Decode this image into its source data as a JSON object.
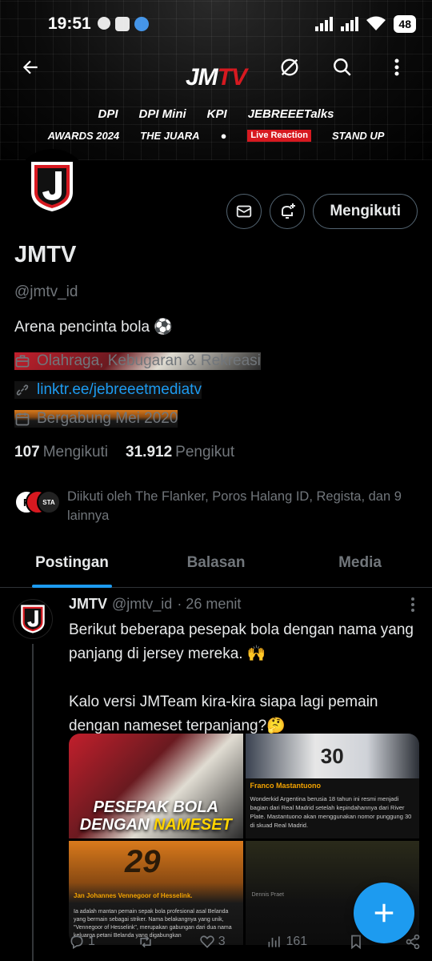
{
  "status_bar": {
    "time": "19:51",
    "battery": "48"
  },
  "banner": {
    "brand_main": "JM",
    "brand_accent": "TV",
    "logos_row1": [
      "DPI",
      "DPI Mini",
      "KPI",
      "JEBREEETalks"
    ],
    "logos_row2": [
      "AWARDS 2024",
      "THE JUARA",
      "●",
      "Live Reaction",
      "STAND UP"
    ]
  },
  "profile": {
    "name": "JMTV",
    "handle": "@jmtv_id",
    "bio": "Arena pencinta bola ⚽",
    "category": "Olahraga, Kebugaran & Rekreasi",
    "link": "linktr.ee/jebreeetmediatv",
    "joined": "Bergabung Mei 2020",
    "following_count": "107",
    "following_label": "Mengikuti",
    "followers_count": "31.912",
    "followers_label": "Pengikut",
    "follow_button": "Mengikuti",
    "followed_by": "Diikuti oleh The Flanker, Poros Halang ID, Regista, dan 9 lainnya"
  },
  "tabs": [
    {
      "label": "Postingan"
    },
    {
      "label": "Balasan"
    },
    {
      "label": "Media"
    }
  ],
  "post": {
    "name": "JMTV",
    "handle": "@jmtv_id",
    "time": "· 26 menit",
    "text": "Berikut beberapa pesepak bola dengan nama yang panjang di jersey mereka. 🙌\n\nKalo versi JMTeam kira-kira siapa lagi pemain dengan nameset terpanjang?🤔",
    "media": {
      "headline_1": "PESEPAK BOLA",
      "headline_2a": "DENGAN ",
      "headline_2b": "NAMESET",
      "m2_jersey": "30",
      "m2_caption": "Franco Mastantuono",
      "m2_text": "Wonderkid Argentina berusia 18 tahun ini resmi menjadi bagian dari Real Madrid setelah kepindahannya dari River Plate. Mastantuono akan menggunakan nomor punggung 30 di skuad Real Madrid.",
      "m3_number": "29",
      "m3_caption": "Jan Johannes Vennegoor of Hesselink.",
      "m3_text": "Ia adalah mantan pemain sepak bola profesional asal Belanda yang bermain sebagai striker. Nama belakangnya yang unik, \"Vennegoor of Hesselink\", merupakan gabungan dari dua nama keluarga petani Belanda yang digabungkan",
      "m4_caption": "Dennis Praet"
    },
    "replies": "1",
    "reposts": "",
    "likes": "3",
    "views": "161"
  },
  "colors": {
    "accent": "#1d9bf0",
    "brand_red": "#d71920",
    "muted": "#71767b"
  }
}
